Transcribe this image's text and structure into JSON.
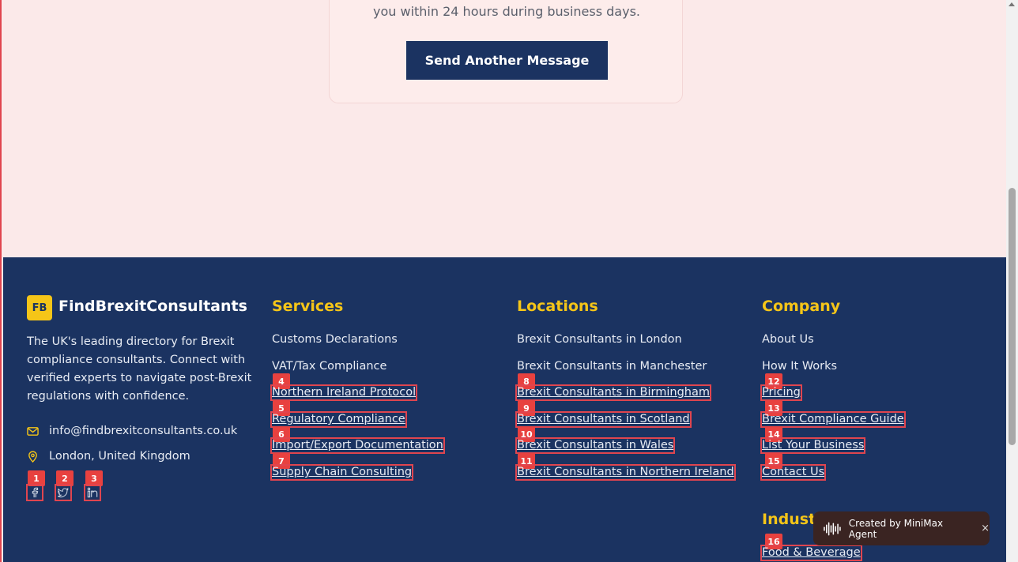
{
  "confirmation": {
    "message_tail": "you within 24 hours during business days.",
    "button_label": "Send Another Message"
  },
  "footer": {
    "logo_initials": "FB",
    "brand_name": "FindBrexitConsultants",
    "about": "The UK's leading directory for Brexit compliance consultants. Connect with verified experts to navigate post-Brexit regulations with confidence.",
    "email": "info@findbrexitconsultants.co.uk",
    "location": "London, United Kingdom",
    "social": [
      {
        "icon": "facebook-icon",
        "marker": "1"
      },
      {
        "icon": "twitter-icon",
        "marker": "2"
      },
      {
        "icon": "linkedin-icon",
        "marker": "3"
      }
    ],
    "services": {
      "title": "Services",
      "items": [
        {
          "label": "Customs Declarations"
        },
        {
          "label": "VAT/Tax Compliance"
        },
        {
          "label": "Northern Ireland Protocol",
          "marker": "4"
        },
        {
          "label": "Regulatory Compliance",
          "marker": "5"
        },
        {
          "label": "Import/Export Documentation",
          "marker": "6"
        },
        {
          "label": "Supply Chain Consulting",
          "marker": "7"
        }
      ]
    },
    "locations": {
      "title": "Locations",
      "items": [
        {
          "label": "Brexit Consultants in London"
        },
        {
          "label": "Brexit Consultants in Manchester"
        },
        {
          "label": "Brexit Consultants in Birmingham",
          "marker": "8"
        },
        {
          "label": "Brexit Consultants in Scotland",
          "marker": "9"
        },
        {
          "label": "Brexit Consultants in Wales",
          "marker": "10"
        },
        {
          "label": "Brexit Consultants in Northern Ireland",
          "marker": "11"
        }
      ]
    },
    "company": {
      "title": "Company",
      "items": [
        {
          "label": "About Us"
        },
        {
          "label": "How It Works"
        },
        {
          "label": "Pricing",
          "marker": "12"
        },
        {
          "label": "Brexit Compliance Guide",
          "marker": "13"
        },
        {
          "label": "List Your Business",
          "marker": "14"
        },
        {
          "label": "Contact Us",
          "marker": "15"
        }
      ]
    },
    "industries": {
      "title": "Industr",
      "items": [
        {
          "label": "Food & Beverage",
          "marker": "16"
        }
      ]
    }
  },
  "toast": {
    "label": "Created by MiniMax Agent",
    "close_glyph": "×"
  },
  "colors": {
    "navy": "#1b3361",
    "accent_yellow": "#f5c518",
    "marker_red": "#e8413f",
    "page_bg": "#fbe9e9"
  }
}
